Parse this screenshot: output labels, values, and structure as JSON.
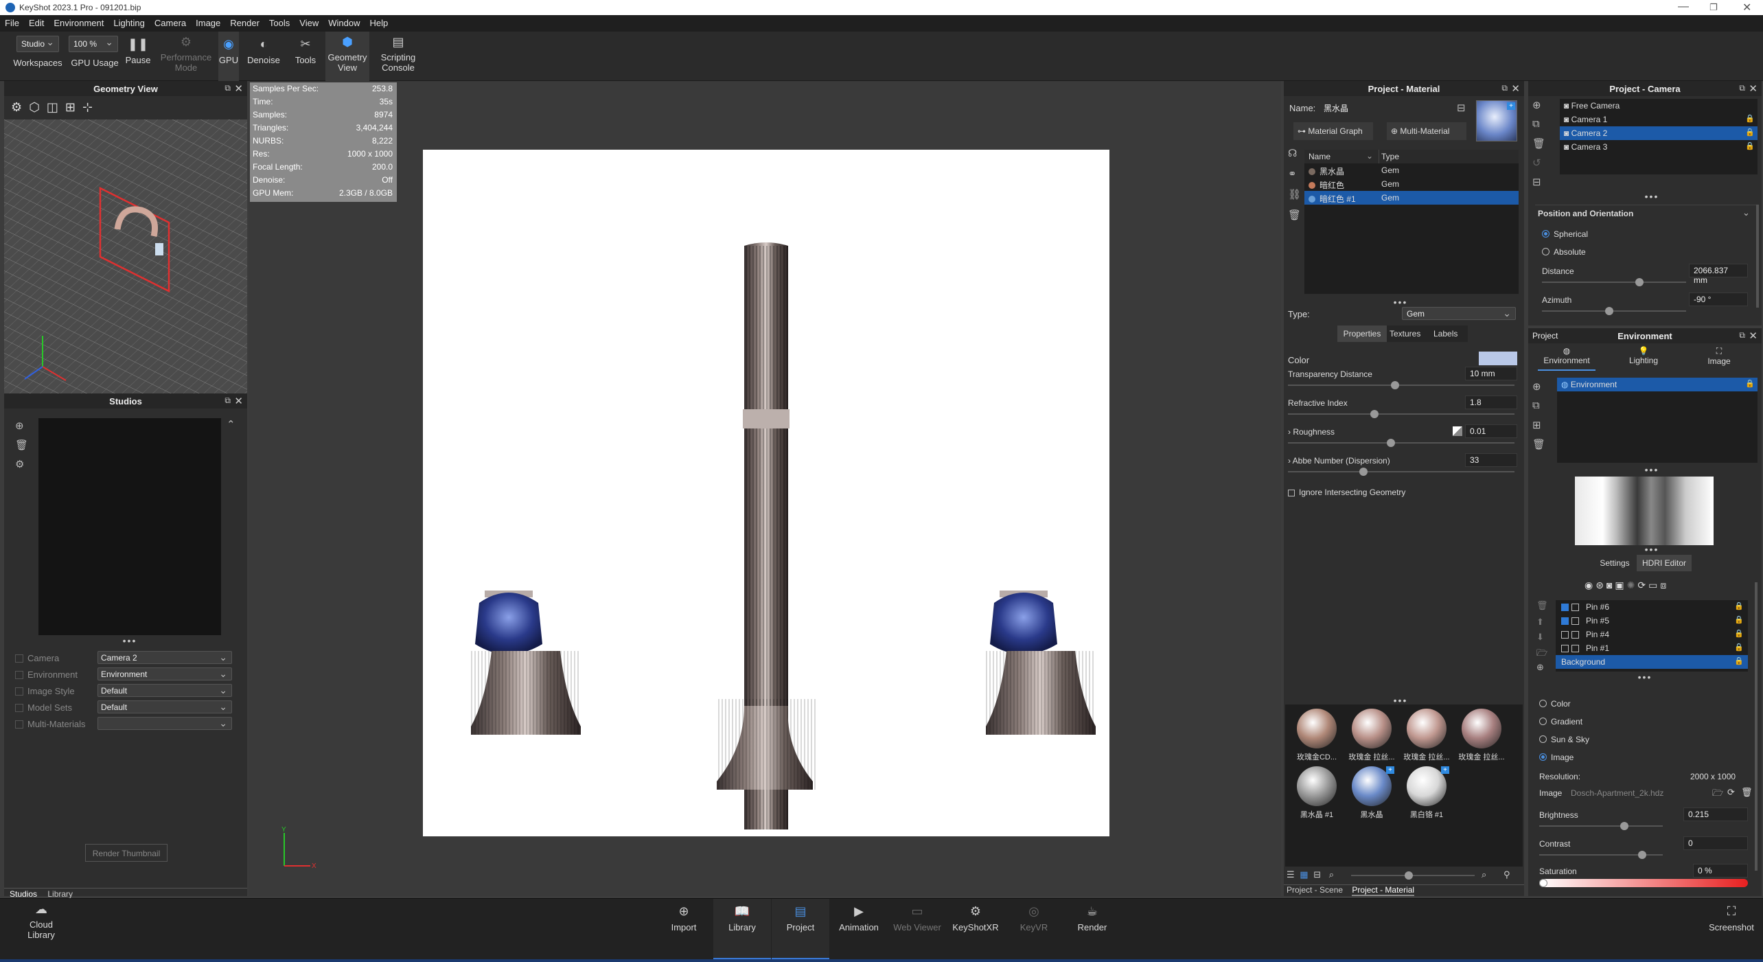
{
  "app": {
    "title": "KeyShot 2023.1 Pro  - 091201.bip"
  },
  "menu": [
    "File",
    "Edit",
    "Environment",
    "Lighting",
    "Camera",
    "Image",
    "Render",
    "Tools",
    "View",
    "Window",
    "Help"
  ],
  "toolbar": {
    "workspace_value": "Studio",
    "workspace_label": "Workspaces",
    "gpu_usage_value": "100 %",
    "gpu_usage_label": "GPU Usage",
    "pause": "Pause",
    "performance": "Performance\nMode",
    "gpu": "GPU",
    "denoise": "Denoise",
    "tools": "Tools",
    "geometry_view": "Geometry\nView",
    "scripting": "Scripting\nConsole"
  },
  "geometry_view": {
    "title": "Geometry View"
  },
  "studios": {
    "title": "Studios",
    "render_thumbnail": "Render Thumbnail",
    "fields": [
      {
        "label": "Camera",
        "value": "Camera 2"
      },
      {
        "label": "Environment",
        "value": "Environment"
      },
      {
        "label": "Image Style",
        "value": "Default"
      },
      {
        "label": "Model Sets",
        "value": "Default"
      },
      {
        "label": "Multi-Materials",
        "value": ""
      }
    ],
    "tabs": [
      "Studios",
      "Library"
    ]
  },
  "stats": [
    {
      "k": "Samples Per Sec:",
      "v": "253.8"
    },
    {
      "k": "Time:",
      "v": "35s"
    },
    {
      "k": "Samples:",
      "v": "8974"
    },
    {
      "k": "Triangles:",
      "v": "3,404,244"
    },
    {
      "k": "NURBS:",
      "v": "8,222"
    },
    {
      "k": "Res:",
      "v": "1000 x 1000"
    },
    {
      "k": "Focal Length:",
      "v": "200.0"
    },
    {
      "k": "Denoise:",
      "v": "Off"
    },
    {
      "k": "GPU Mem:",
      "v": "2.3GB / 8.0GB"
    }
  ],
  "axis": {
    "y": "Y",
    "x": "X"
  },
  "material": {
    "title": "Project - Material",
    "name_label": "Name:",
    "name_value": "黑水晶",
    "material_graph": "Material Graph",
    "multi_material": "Multi-Material",
    "col_name": "Name",
    "col_type": "Type",
    "rows": [
      {
        "name": "黑水晶",
        "type": "Gem",
        "swatch": "#7a6a60"
      },
      {
        "name": "暗红色",
        "type": "Gem",
        "swatch": "#c47a5a"
      },
      {
        "name": "暗红色 #1",
        "type": "Gem",
        "swatch": "#6aa0d8"
      }
    ],
    "type_label": "Type:",
    "type_value": "Gem",
    "tabs": [
      "Properties",
      "Textures",
      "Labels"
    ],
    "color_label": "Color",
    "color_value": "#b9c8e8",
    "props": [
      {
        "label": "Transparency Distance",
        "value": "10 mm",
        "knob": 0.75
      },
      {
        "label": "Refractive Index",
        "value": "1.8",
        "knob": 0.6
      },
      {
        "label": "Roughness",
        "value": "0.01",
        "knob": 0.72
      },
      {
        "label": "Abbe Number (Dispersion)",
        "value": "33",
        "knob": 0.52
      }
    ],
    "ignore": "Ignore Intersecting Geometry",
    "library": [
      {
        "label": "玫瑰金CD...",
        "color": "#b08878"
      },
      {
        "label": "玫瑰金 拉丝...",
        "color": "#b89088"
      },
      {
        "label": "玫瑰金 拉丝...",
        "color": "#c09890"
      },
      {
        "label": "玫瑰金 拉丝...",
        "color": "#a88080"
      },
      {
        "label": "黑水晶 #1",
        "color": "#9a9a9a"
      },
      {
        "label": "黑水晶",
        "color": "#6a8ac8"
      },
      {
        "label": "黑白铬 #1",
        "color": "#d8d8d8"
      }
    ],
    "bottom_tabs": [
      "Project - Scene",
      "Project - Material"
    ]
  },
  "camera": {
    "title": "Project - Camera",
    "list": [
      "Free Camera",
      "Camera 1",
      "Camera 2",
      "Camera 3"
    ],
    "selected": 2,
    "section": "Position and Orientation",
    "spherical": "Spherical",
    "absolute": "Absolute",
    "distance_label": "Distance",
    "distance_value": "2066.837 mm",
    "azimuth_label": "Azimuth",
    "azimuth_value": "-90 °"
  },
  "environment": {
    "project_tab": "Project",
    "title": "Environment",
    "tabs": [
      "Environment",
      "Lighting",
      "Image"
    ],
    "list": [
      "Environment"
    ],
    "settings": "Settings",
    "hdri_editor": "HDRI Editor",
    "pins": [
      {
        "name": "Pin #6",
        "checked": true
      },
      {
        "name": "Pin #5",
        "checked": true
      },
      {
        "name": "Pin #4",
        "checked": false
      },
      {
        "name": "Pin #1",
        "checked": false
      },
      {
        "name": "Background",
        "checked": false
      }
    ],
    "bg_options": [
      "Color",
      "Gradient",
      "Sun & Sky",
      "Image"
    ],
    "bg_selected": 3,
    "resolution_label": "Resolution:",
    "resolution_value": "2000 x 1000",
    "image_label": "Image",
    "image_value": "Dosch-Apartment_2k.hdz",
    "brightness_label": "Brightness",
    "brightness_value": "0.215",
    "contrast_label": "Contrast",
    "contrast_value": "0",
    "saturation_label": "Saturation",
    "saturation_value": "0 %"
  },
  "ribbon": {
    "cloud_library": "Cloud\nLibrary",
    "items": [
      "Import",
      "Library",
      "Project",
      "Animation",
      "Web Viewer",
      "KeyShotXR",
      "KeyVR",
      "Render"
    ],
    "screenshot": "Screenshot"
  }
}
